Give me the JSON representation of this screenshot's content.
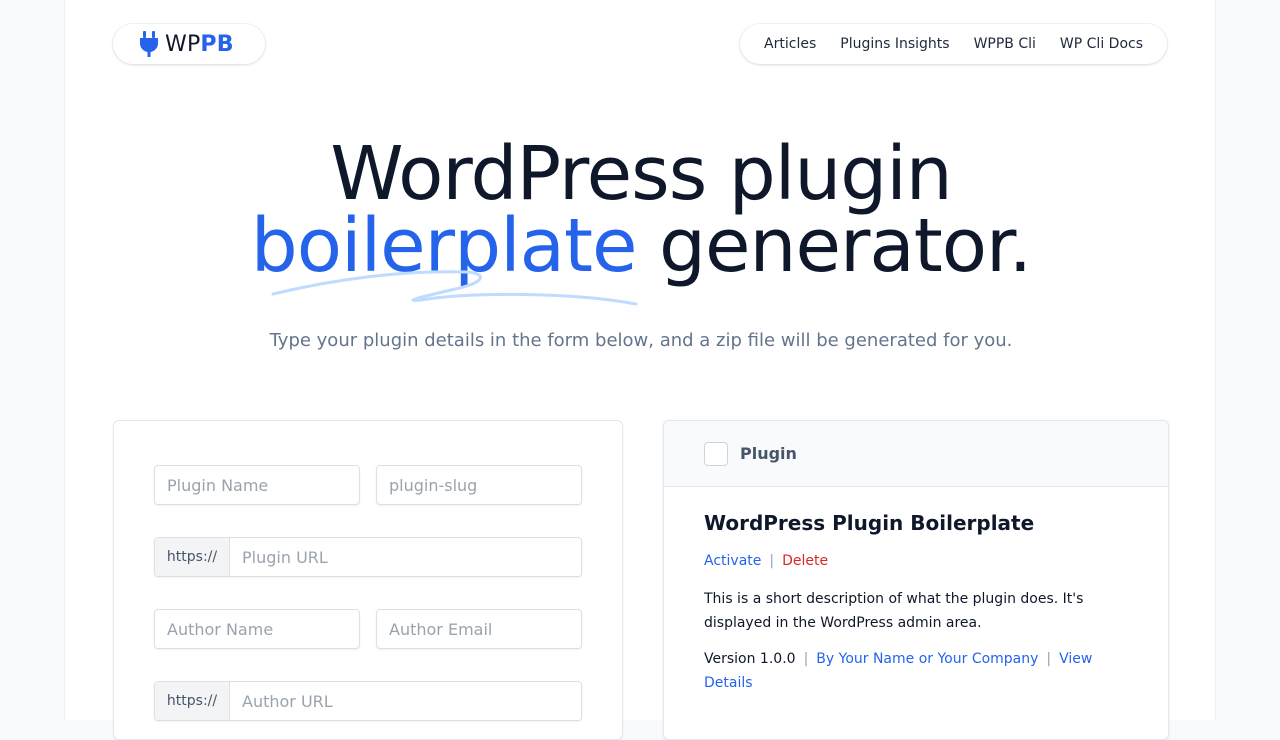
{
  "brand": {
    "prefix": "WP",
    "accent": "PB",
    "accent_color": "#2563eb",
    "icon": "plug-icon"
  },
  "nav": {
    "items": [
      {
        "label": "Articles"
      },
      {
        "label": "Plugins Insights"
      },
      {
        "label": "WPPB Cli"
      },
      {
        "label": "WP Cli Docs"
      }
    ]
  },
  "hero": {
    "line1": "WordPress plugin",
    "highlight": "boilerplate",
    "line2_rest": " generator.",
    "subtitle": "Type your plugin details in the form below, and a zip file will be generated for you."
  },
  "form": {
    "plugin_name_placeholder": "Plugin Name",
    "plugin_slug_placeholder": "plugin-slug",
    "url_prefix": "https://",
    "plugin_url_placeholder": "Plugin URL",
    "author_name_placeholder": "Author Name",
    "author_email_placeholder": "Author Email",
    "author_url_prefix": "https://",
    "author_url_placeholder": "Author URL"
  },
  "preview": {
    "header_label": "Plugin",
    "title": "WordPress Plugin Boilerplate",
    "activate": "Activate",
    "delete": "Delete",
    "action_separator": "|",
    "description": "This is a short description of what the plugin does. It's displayed in the WordPress admin area.",
    "version": "Version 1.0.0",
    "author": "By Your Name or Your Company",
    "view_details": "View Details"
  }
}
